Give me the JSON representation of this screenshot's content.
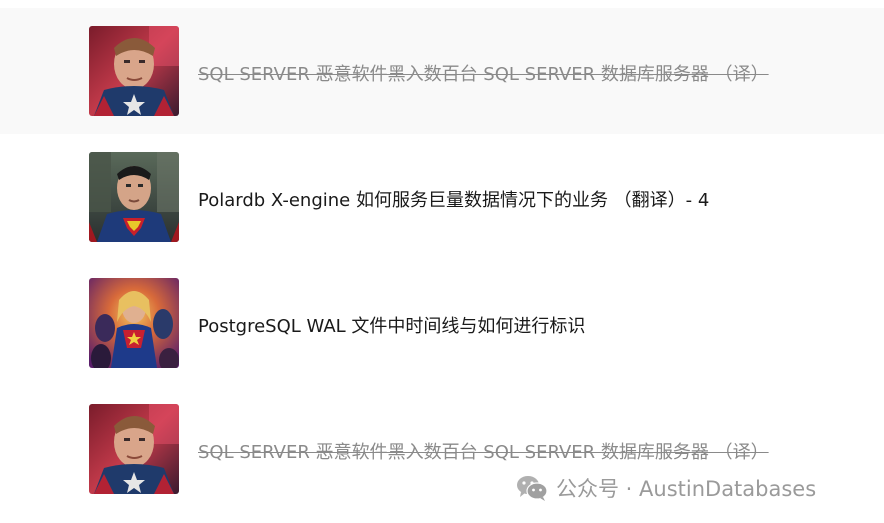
{
  "articles": [
    {
      "title": "SQL SERVER  恶意软件黑入数百台 SQL SERVER 数据库服务器 （译）",
      "thumbnail": "captain-america-thumbnail",
      "strikethrough": true
    },
    {
      "title": "Polardb X-engine 如何服务巨量数据情况下的业务 （翻译）- 4",
      "thumbnail": "superman-thumbnail",
      "strikethrough": false
    },
    {
      "title": "PostgreSQL WAL 文件中时间线与如何进行标识",
      "thumbnail": "captain-marvel-thumbnail",
      "strikethrough": false
    },
    {
      "title": "SQL SERVER  恶意软件黑入数百台 SQL SERVER 数据库服务器 （译）",
      "thumbnail": "captain-america-thumbnail",
      "strikethrough": true
    }
  ],
  "watermark": {
    "icon": "wechat-icon",
    "text": "公众号 · AustinDatabases"
  },
  "colors": {
    "highlight_row": "#f9f9f9",
    "title_text": "#1a1a1a",
    "strike_text": "#8a8a8a",
    "watermark_text": "#9a9a9a"
  }
}
